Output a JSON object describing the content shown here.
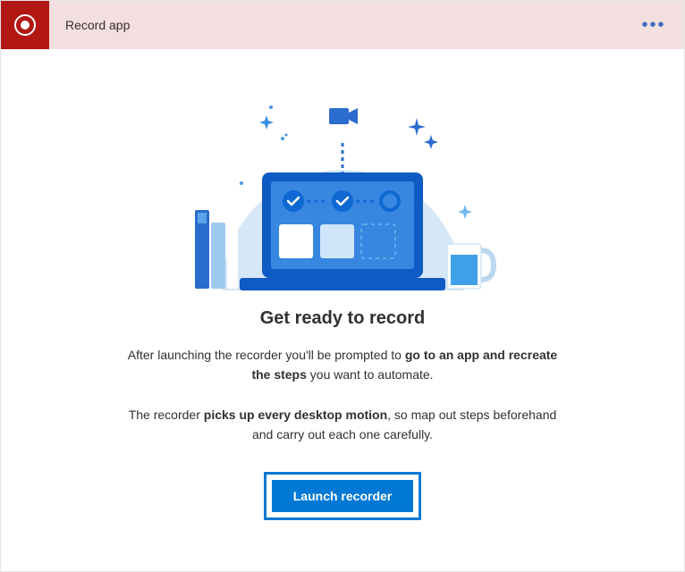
{
  "header": {
    "title": "Record app",
    "more_label": "•••"
  },
  "content": {
    "heading": "Get ready to record",
    "p1_pre": "After launching the recorder you'll be prompted to ",
    "p1_strong": "go to an app and recreate the steps",
    "p1_post": " you want to automate.",
    "p2_pre": "The recorder ",
    "p2_strong": "picks up every desktop motion",
    "p2_post": ", so map out steps beforehand and carry out each one carefully.",
    "button_label": "Launch recorder"
  }
}
